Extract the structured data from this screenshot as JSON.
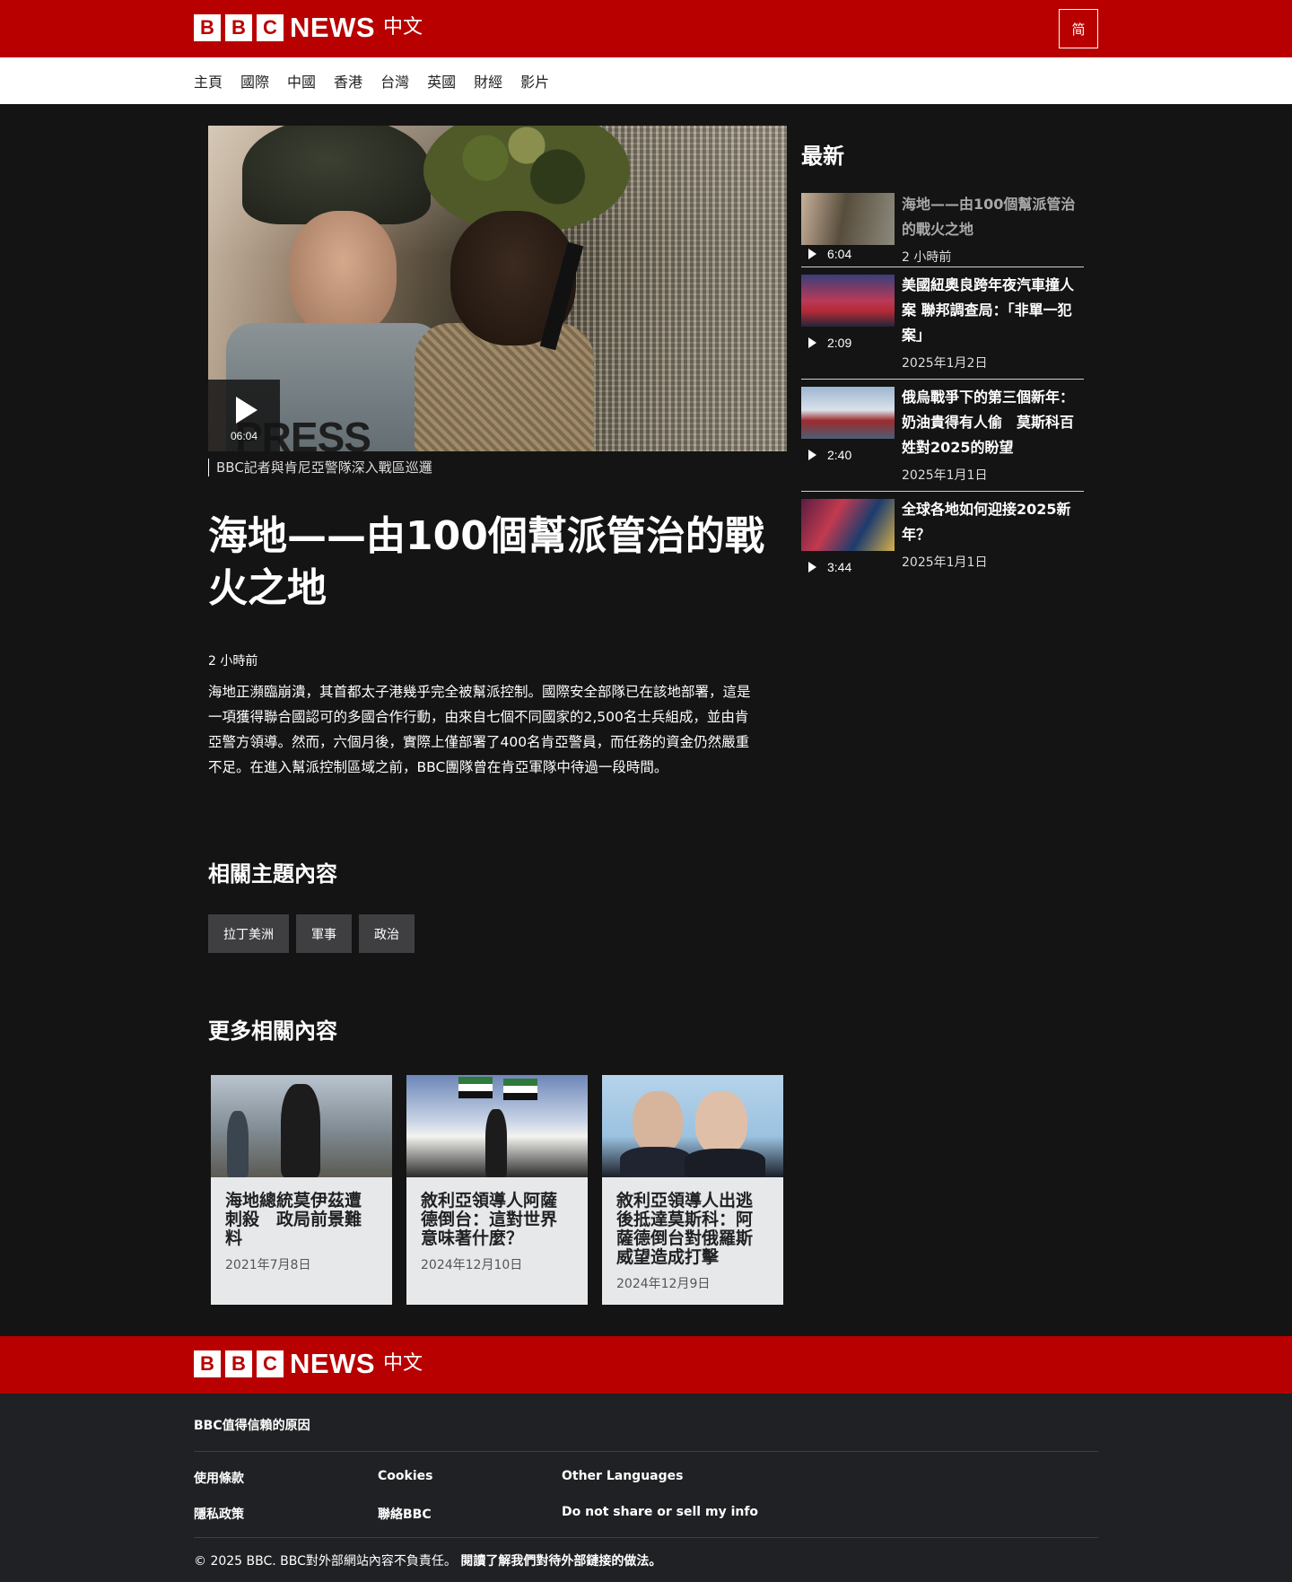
{
  "header": {
    "bbc_letters": [
      "B",
      "B",
      "C"
    ],
    "news": "NEWS",
    "zh": "中文",
    "script_toggle": "简"
  },
  "nav": [
    "主頁",
    "國際",
    "中國",
    "香港",
    "台灣",
    "英國",
    "財經",
    "影片"
  ],
  "hero": {
    "duration": "06:04",
    "press_text": "PRESS",
    "caption": "BBC記者與肯尼亞警隊深入戰區巡邏",
    "headline": "海地——由100個幫派管治的戰火之地",
    "timestamp": "2 小時前",
    "summary": "海地正瀕臨崩潰，其首都太子港幾乎完全被幫派控制。國際安全部隊已在該地部署，這是一項獲得聯合國認可的多國合作行動，由來自七個不同國家的2,500名士兵組成，並由肯亞警方領導。然而，六個月後，實際上僅部署了400名肯亞警員，而任務的資金仍然嚴重不足。在進入幫派控制區域之前，BBC團隊曾在肯亞軍隊中待過一段時間。"
  },
  "topics": {
    "heading": "相關主題內容",
    "items": [
      "拉丁美洲",
      "軍事",
      "政治"
    ]
  },
  "more": {
    "heading": "更多相關內容",
    "cards": [
      {
        "title": "海地總統莫伊茲遭刺殺　政局前景難料",
        "date": "2021年7月8日"
      },
      {
        "title": "敘利亞領導人阿薩德倒台：這對世界意味著什麼？",
        "date": "2024年12月10日"
      },
      {
        "title": "敘利亞領導人出逃後抵達莫斯科：阿薩德倒台對俄羅斯威望造成打擊",
        "date": "2024年12月9日"
      }
    ]
  },
  "latest": {
    "heading": "最新",
    "items": [
      {
        "duration": "6:04",
        "title": "海地——由100個幫派管治的戰火之地",
        "date": "2 小時前",
        "visited": true
      },
      {
        "duration": "2:09",
        "title": "美國紐奧良跨年夜汽車撞人案 聯邦調查局：「非單一犯案」",
        "date": "2025年1月2日",
        "visited": false
      },
      {
        "duration": "2:40",
        "title": "俄烏戰爭下的第三個新年：奶油貴得有人偷　莫斯科百姓對2025的盼望",
        "date": "2025年1月1日",
        "visited": false
      },
      {
        "duration": "3:44",
        "title": "全球各地如何迎接2025新年？",
        "date": "2025年1月1日",
        "visited": false
      }
    ]
  },
  "footer": {
    "trust": "BBC值得信賴的原因",
    "links": [
      "使用條款",
      "Cookies",
      "Other Languages",
      "隱私政策",
      "聯絡BBC",
      "Do not share or sell my info"
    ],
    "copyright": "© 2025 BBC. BBC對外部網站內容不負責任。",
    "external_link": "閱讀了解我們對待外部鏈接的做法。"
  }
}
